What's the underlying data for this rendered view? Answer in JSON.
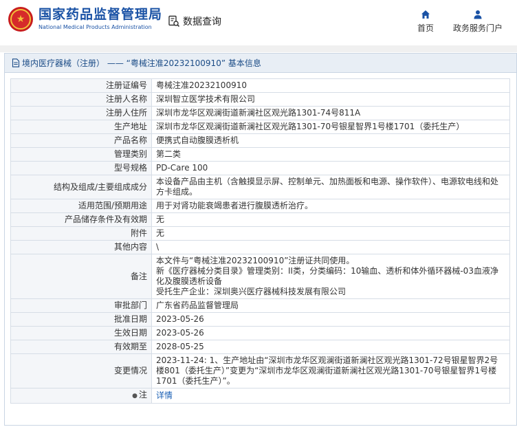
{
  "header": {
    "logo_cn": "国家药品监督管理局",
    "logo_en": "National Medical Products Administration",
    "query_label": "数据查询",
    "nav": [
      {
        "label": "首页",
        "icon": "home-icon"
      },
      {
        "label": "政务服务门户",
        "icon": "user-icon"
      }
    ]
  },
  "panel": {
    "title": "境内医疗器械（注册） —— “粤械注准20232100910” 基本信息"
  },
  "rows": [
    {
      "label": "注册证编号",
      "value": "粤械注准20232100910"
    },
    {
      "label": "注册人名称",
      "value": "深圳智立医学技术有限公司"
    },
    {
      "label": "注册人住所",
      "value": "深圳市龙华区观澜街道新澜社区观光路1301-74号811A"
    },
    {
      "label": "生产地址",
      "value": "深圳市龙华区观澜街道新澜社区观光路1301-70号银星智界1号楼1701（委托生产）"
    },
    {
      "label": "产品名称",
      "value": "便携式自动腹膜透析机"
    },
    {
      "label": "管理类别",
      "value": "第二类"
    },
    {
      "label": "型号规格",
      "value": "PD-Care 100"
    },
    {
      "label": "结构及组成/主要组成成分",
      "value": "本设备产品由主机（含触摸显示屏、控制单元、加热面板和电源、操作软件）、电源软电线和处方卡组成。"
    },
    {
      "label": "适用范围/预期用途",
      "value": "用于对肾功能衰竭患者进行腹膜透析治疗。"
    },
    {
      "label": "产品储存条件及有效期",
      "value": "无"
    },
    {
      "label": "附件",
      "value": "无"
    },
    {
      "label": "其他内容",
      "value": "\\"
    },
    {
      "label": "备注",
      "value": "本文件与“粤械注准20232100910”注册证共同使用。\n新《医疗器械分类目录》管理类别：II类，分类编码：10输血、透析和体外循环器械-03血液净化及腹膜透析设备\n受托生产企业：深圳奥兴医疗器械科技发展有限公司"
    },
    {
      "label": "审批部门",
      "value": "广东省药品监督管理局"
    },
    {
      "label": "批准日期",
      "value": "2023-05-26"
    },
    {
      "label": "生效日期",
      "value": "2023-05-26"
    },
    {
      "label": "有效期至",
      "value": "2028-05-25"
    },
    {
      "label": "变更情况",
      "value": "2023-11-24: 1、生产地址由“深圳市龙华区观澜街道新澜社区观光路1301-72号银星智界2号楼801（委托生产）”变更为“深圳市龙华区观澜街道新澜社区观光路1301-70号银星智界1号楼1701（委托生产）”。"
    }
  ],
  "note": {
    "label": "注",
    "link": "详情"
  }
}
